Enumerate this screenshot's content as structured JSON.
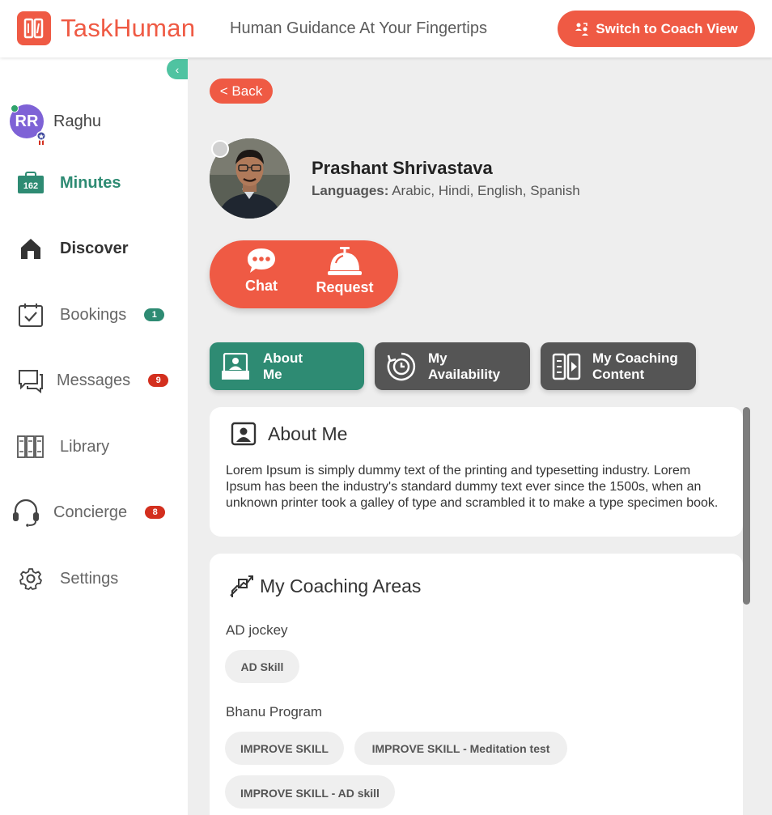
{
  "header": {
    "brand": "TaskHuman",
    "tagline": "Human Guidance At Your Fingertips",
    "switch_button": "Switch to Coach View"
  },
  "sidebar": {
    "user": {
      "initials": "RR",
      "name": "Raghu"
    },
    "items": [
      {
        "label": "Minutes",
        "icon": "wallet-icon",
        "value": "162",
        "color": "#2e8b73"
      },
      {
        "label": "Discover",
        "icon": "home-icon"
      },
      {
        "label": "Bookings",
        "icon": "calendar-check-icon",
        "count": "1",
        "count_color": "#2e8b73"
      },
      {
        "label": "Messages",
        "icon": "chat-icon",
        "count": "9",
        "count_color": "#d32f1e"
      },
      {
        "label": "Library",
        "icon": "books-icon"
      },
      {
        "label": "Concierge",
        "icon": "headset-icon",
        "count": "8",
        "count_color": "#d32f1e"
      },
      {
        "label": "Settings",
        "icon": "gear-icon"
      }
    ]
  },
  "profile": {
    "back_label": "< Back",
    "name": "Prashant Shrivastava",
    "languages_label": "Languages:",
    "languages": "Arabic, Hindi, English, Spanish",
    "actions": [
      {
        "label": "Chat",
        "icon": "chat-bubble-icon"
      },
      {
        "label": "Request",
        "icon": "service-bell-icon"
      }
    ]
  },
  "tabs": [
    {
      "line1": "About",
      "line2": "Me",
      "icon": "profile-card-icon",
      "active": true
    },
    {
      "line1": "My",
      "line2": "Availability",
      "icon": "clock-icon",
      "active": false
    },
    {
      "line1": "My Coaching",
      "line2": "Content",
      "icon": "content-icon",
      "active": false
    }
  ],
  "about": {
    "title": "About Me",
    "text": "Lorem Ipsum is simply dummy text of the printing and typesetting industry. Lorem Ipsum has been the industry's standard dummy text ever since the 1500s, when an unknown printer took a galley of type and scrambled it to make a type specimen book."
  },
  "coaching_areas": {
    "title": "My Coaching Areas",
    "programs": [
      {
        "name": "AD jockey",
        "skills": [
          "AD Skill"
        ]
      },
      {
        "name": "Bhanu Program",
        "skills": [
          "IMPROVE SKILL",
          "IMPROVE SKILL - Meditation test",
          "IMPROVE SKILL - AD skill"
        ]
      }
    ]
  }
}
